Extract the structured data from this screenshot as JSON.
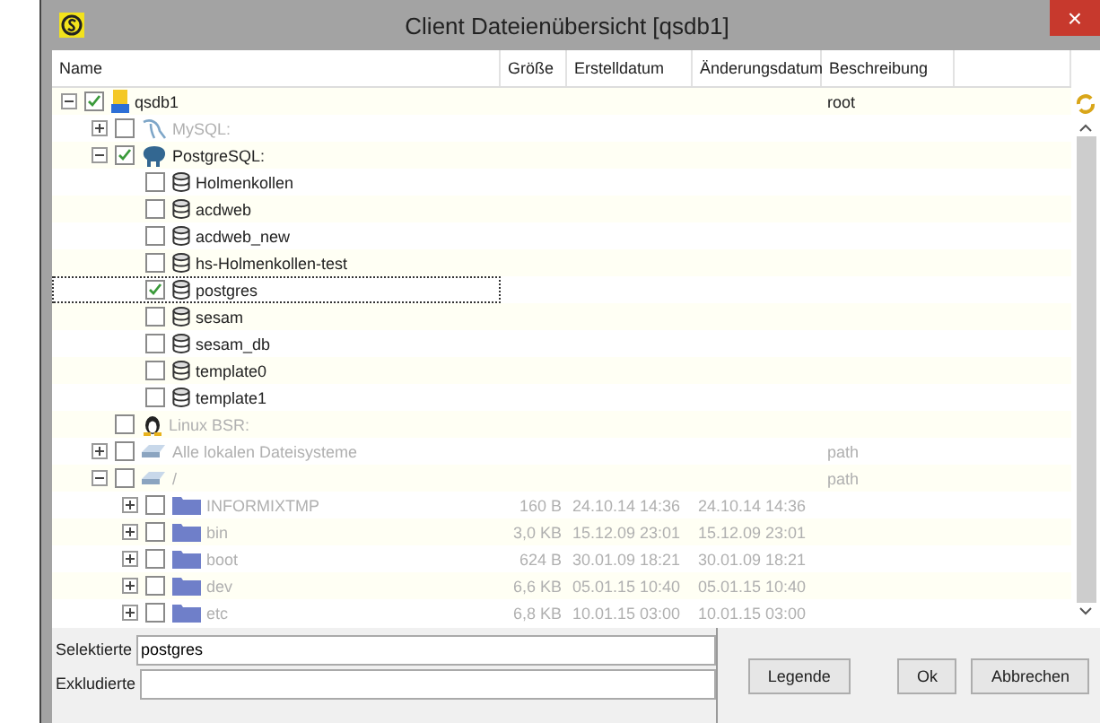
{
  "window": {
    "title": "Client Dateienübersicht [qsdb1]",
    "close": "×"
  },
  "columns": [
    "Name",
    "Größe",
    "Erstelldatum",
    "Änderungsdatum",
    "Beschreibung"
  ],
  "tree": [
    {
      "name": "qsdb1",
      "kind": "server",
      "checked": true,
      "expanded": true,
      "disabled": false,
      "selected": false,
      "description": "root",
      "children": [
        {
          "name": "MySQL:",
          "kind": "mysql",
          "checked": false,
          "expanded": false,
          "disabled": true,
          "selected": false
        },
        {
          "name": "PostgreSQL:",
          "kind": "postgres",
          "checked": true,
          "expanded": true,
          "disabled": false,
          "selected": false,
          "children": [
            {
              "name": "Holmenkollen",
              "kind": "database",
              "checked": false,
              "disabled": false,
              "selected": false
            },
            {
              "name": "acdweb",
              "kind": "database",
              "checked": false,
              "disabled": false,
              "selected": false
            },
            {
              "name": "acdweb_new",
              "kind": "database",
              "checked": false,
              "disabled": false,
              "selected": false
            },
            {
              "name": "hs-Holmenkollen-test",
              "kind": "database",
              "checked": false,
              "disabled": false,
              "selected": false
            },
            {
              "name": "postgres",
              "kind": "database",
              "checked": true,
              "disabled": false,
              "selected": true
            },
            {
              "name": "sesam",
              "kind": "database",
              "checked": false,
              "disabled": false,
              "selected": false
            },
            {
              "name": "sesam_db",
              "kind": "database",
              "checked": false,
              "disabled": false,
              "selected": false
            },
            {
              "name": "template0",
              "kind": "database",
              "checked": false,
              "disabled": false,
              "selected": false
            },
            {
              "name": "template1",
              "kind": "database",
              "checked": false,
              "disabled": false,
              "selected": false
            }
          ]
        },
        {
          "name": "Linux BSR:",
          "kind": "linux",
          "checked": false,
          "disabled": true,
          "selected": false
        },
        {
          "name": "Alle lokalen Dateisysteme",
          "kind": "drive",
          "checked": false,
          "expanded": false,
          "disabled": true,
          "selected": false,
          "description": "path"
        },
        {
          "name": "/",
          "kind": "drive",
          "checked": false,
          "expanded": true,
          "disabled": true,
          "selected": false,
          "description": "path",
          "children": [
            {
              "name": "INFORMIXTMP",
              "kind": "folder",
              "checked": false,
              "expanded": false,
              "disabled": true,
              "selected": false,
              "size": "160  B",
              "created": "24.10.14 14:36",
              "modified": "24.10.14 14:36"
            },
            {
              "name": "bin",
              "kind": "folder",
              "checked": false,
              "expanded": false,
              "disabled": true,
              "selected": false,
              "size": "3,0 KB",
              "created": "15.12.09 23:01",
              "modified": "15.12.09 23:01"
            },
            {
              "name": "boot",
              "kind": "folder",
              "checked": false,
              "expanded": false,
              "disabled": true,
              "selected": false,
              "size": "624  B",
              "created": "30.01.09 18:21",
              "modified": "30.01.09 18:21"
            },
            {
              "name": "dev",
              "kind": "folder",
              "checked": false,
              "expanded": false,
              "disabled": true,
              "selected": false,
              "size": "6,6 KB",
              "created": "05.01.15 10:40",
              "modified": "05.01.15 10:40"
            },
            {
              "name": "etc",
              "kind": "folder",
              "checked": false,
              "expanded": false,
              "disabled": true,
              "selected": false,
              "size": "6,8 KB",
              "created": "10.01.15 03:00",
              "modified": "10.01.15 03:00"
            }
          ]
        }
      ]
    }
  ],
  "selected_field": {
    "label": "Selektierte",
    "value": "postgres"
  },
  "excluded_field": {
    "label": "Exkludierte"
  },
  "buttons": [
    "Legende",
    "Ok",
    "Abbrechen"
  ]
}
